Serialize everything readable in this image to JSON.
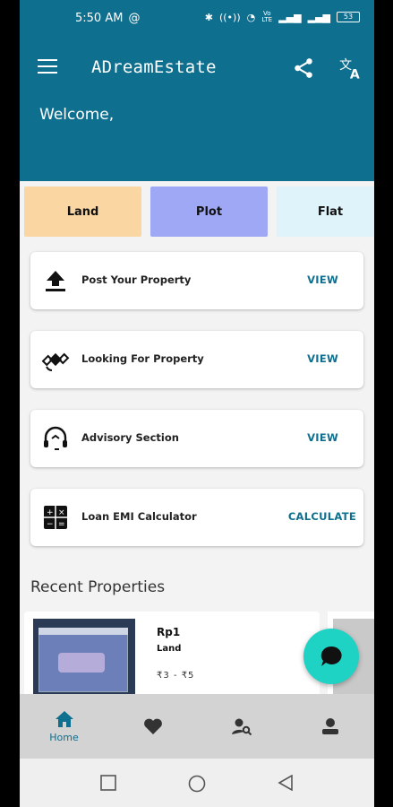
{
  "status_bar": {
    "time": "5:50 AM",
    "net_label": "Vo LTE",
    "battery": "53"
  },
  "app_bar": {
    "title": "ADreamEstate",
    "welcome": "Welcome,"
  },
  "categories": [
    {
      "label": "Land",
      "color": "#f9d6a2"
    },
    {
      "label": "Plot",
      "color": "#9fa8f4"
    },
    {
      "label": "Flat",
      "color": "#dff3fb"
    }
  ],
  "actions": [
    {
      "label": "Post Your Property",
      "action": "VIEW",
      "icon": "upload-icon"
    },
    {
      "label": "Looking For Property",
      "action": "VIEW",
      "icon": "satellite-icon"
    },
    {
      "label": "Advisory Section",
      "action": "VIEW",
      "icon": "support-headset-icon"
    },
    {
      "label": "Loan EMI Calculator",
      "action": "CALCULATE",
      "icon": "calculator-icon"
    }
  ],
  "recent": {
    "title": "Recent Properties",
    "items": [
      {
        "name": "Rp1",
        "type": "Land",
        "price": "₹3 - ₹5"
      }
    ]
  },
  "bottom_nav": [
    {
      "label": "Home",
      "icon": "home-icon",
      "active": true
    },
    {
      "label": "",
      "icon": "heart-icon",
      "active": false
    },
    {
      "label": "",
      "icon": "user-search-icon",
      "active": false
    },
    {
      "label": "",
      "icon": "profile-icon",
      "active": false
    }
  ],
  "colors": {
    "primary": "#0f6f8f",
    "fab": "#1ed3c4"
  }
}
